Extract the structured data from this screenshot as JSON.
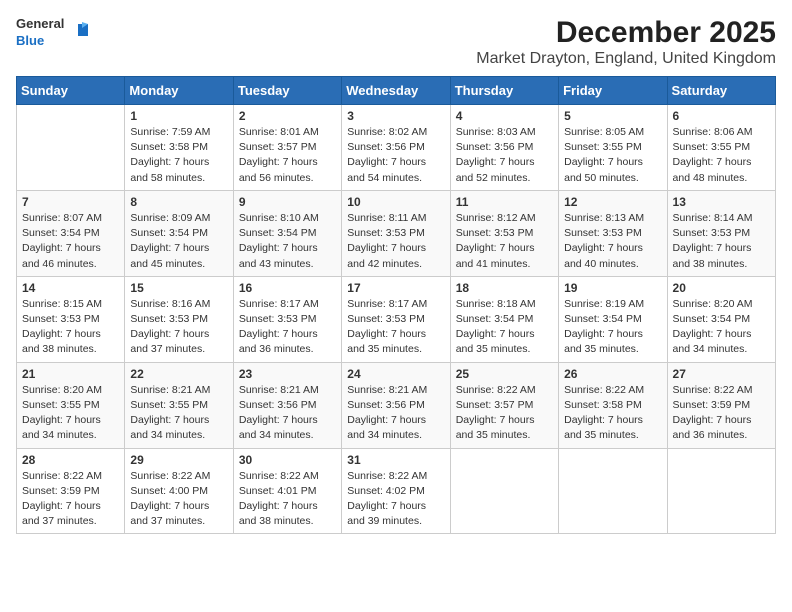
{
  "header": {
    "logo_line1": "General",
    "logo_line2": "Blue",
    "main_title": "December 2025",
    "subtitle": "Market Drayton, England, United Kingdom"
  },
  "days_of_week": [
    "Sunday",
    "Monday",
    "Tuesday",
    "Wednesday",
    "Thursday",
    "Friday",
    "Saturday"
  ],
  "weeks": [
    [
      {
        "day": "",
        "info": ""
      },
      {
        "day": "1",
        "info": "Sunrise: 7:59 AM\nSunset: 3:58 PM\nDaylight: 7 hours\nand 58 minutes."
      },
      {
        "day": "2",
        "info": "Sunrise: 8:01 AM\nSunset: 3:57 PM\nDaylight: 7 hours\nand 56 minutes."
      },
      {
        "day": "3",
        "info": "Sunrise: 8:02 AM\nSunset: 3:56 PM\nDaylight: 7 hours\nand 54 minutes."
      },
      {
        "day": "4",
        "info": "Sunrise: 8:03 AM\nSunset: 3:56 PM\nDaylight: 7 hours\nand 52 minutes."
      },
      {
        "day": "5",
        "info": "Sunrise: 8:05 AM\nSunset: 3:55 PM\nDaylight: 7 hours\nand 50 minutes."
      },
      {
        "day": "6",
        "info": "Sunrise: 8:06 AM\nSunset: 3:55 PM\nDaylight: 7 hours\nand 48 minutes."
      }
    ],
    [
      {
        "day": "7",
        "info": "Sunrise: 8:07 AM\nSunset: 3:54 PM\nDaylight: 7 hours\nand 46 minutes."
      },
      {
        "day": "8",
        "info": "Sunrise: 8:09 AM\nSunset: 3:54 PM\nDaylight: 7 hours\nand 45 minutes."
      },
      {
        "day": "9",
        "info": "Sunrise: 8:10 AM\nSunset: 3:54 PM\nDaylight: 7 hours\nand 43 minutes."
      },
      {
        "day": "10",
        "info": "Sunrise: 8:11 AM\nSunset: 3:53 PM\nDaylight: 7 hours\nand 42 minutes."
      },
      {
        "day": "11",
        "info": "Sunrise: 8:12 AM\nSunset: 3:53 PM\nDaylight: 7 hours\nand 41 minutes."
      },
      {
        "day": "12",
        "info": "Sunrise: 8:13 AM\nSunset: 3:53 PM\nDaylight: 7 hours\nand 40 minutes."
      },
      {
        "day": "13",
        "info": "Sunrise: 8:14 AM\nSunset: 3:53 PM\nDaylight: 7 hours\nand 38 minutes."
      }
    ],
    [
      {
        "day": "14",
        "info": "Sunrise: 8:15 AM\nSunset: 3:53 PM\nDaylight: 7 hours\nand 38 minutes."
      },
      {
        "day": "15",
        "info": "Sunrise: 8:16 AM\nSunset: 3:53 PM\nDaylight: 7 hours\nand 37 minutes."
      },
      {
        "day": "16",
        "info": "Sunrise: 8:17 AM\nSunset: 3:53 PM\nDaylight: 7 hours\nand 36 minutes."
      },
      {
        "day": "17",
        "info": "Sunrise: 8:17 AM\nSunset: 3:53 PM\nDaylight: 7 hours\nand 35 minutes."
      },
      {
        "day": "18",
        "info": "Sunrise: 8:18 AM\nSunset: 3:54 PM\nDaylight: 7 hours\nand 35 minutes."
      },
      {
        "day": "19",
        "info": "Sunrise: 8:19 AM\nSunset: 3:54 PM\nDaylight: 7 hours\nand 35 minutes."
      },
      {
        "day": "20",
        "info": "Sunrise: 8:20 AM\nSunset: 3:54 PM\nDaylight: 7 hours\nand 34 minutes."
      }
    ],
    [
      {
        "day": "21",
        "info": "Sunrise: 8:20 AM\nSunset: 3:55 PM\nDaylight: 7 hours\nand 34 minutes."
      },
      {
        "day": "22",
        "info": "Sunrise: 8:21 AM\nSunset: 3:55 PM\nDaylight: 7 hours\nand 34 minutes."
      },
      {
        "day": "23",
        "info": "Sunrise: 8:21 AM\nSunset: 3:56 PM\nDaylight: 7 hours\nand 34 minutes."
      },
      {
        "day": "24",
        "info": "Sunrise: 8:21 AM\nSunset: 3:56 PM\nDaylight: 7 hours\nand 34 minutes."
      },
      {
        "day": "25",
        "info": "Sunrise: 8:22 AM\nSunset: 3:57 PM\nDaylight: 7 hours\nand 35 minutes."
      },
      {
        "day": "26",
        "info": "Sunrise: 8:22 AM\nSunset: 3:58 PM\nDaylight: 7 hours\nand 35 minutes."
      },
      {
        "day": "27",
        "info": "Sunrise: 8:22 AM\nSunset: 3:59 PM\nDaylight: 7 hours\nand 36 minutes."
      }
    ],
    [
      {
        "day": "28",
        "info": "Sunrise: 8:22 AM\nSunset: 3:59 PM\nDaylight: 7 hours\nand 37 minutes."
      },
      {
        "day": "29",
        "info": "Sunrise: 8:22 AM\nSunset: 4:00 PM\nDaylight: 7 hours\nand 37 minutes."
      },
      {
        "day": "30",
        "info": "Sunrise: 8:22 AM\nSunset: 4:01 PM\nDaylight: 7 hours\nand 38 minutes."
      },
      {
        "day": "31",
        "info": "Sunrise: 8:22 AM\nSunset: 4:02 PM\nDaylight: 7 hours\nand 39 minutes."
      },
      {
        "day": "",
        "info": ""
      },
      {
        "day": "",
        "info": ""
      },
      {
        "day": "",
        "info": ""
      }
    ]
  ]
}
